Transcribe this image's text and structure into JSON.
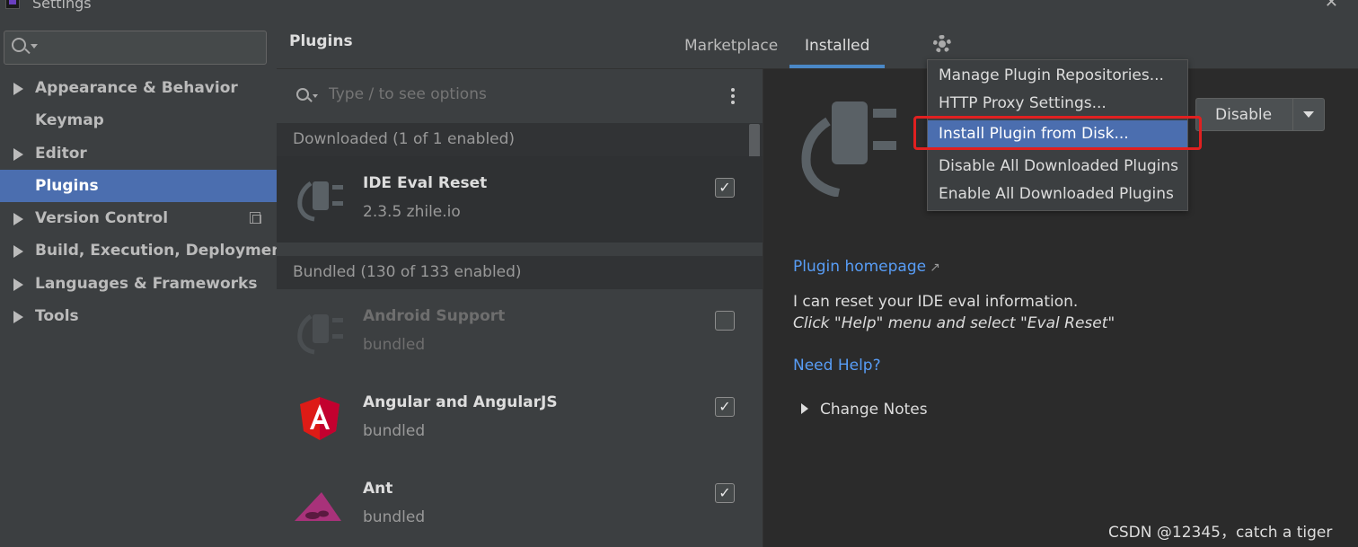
{
  "window": {
    "title": "Settings"
  },
  "sidebar": {
    "search_placeholder": "",
    "items": [
      {
        "label": "Appearance & Behavior",
        "expandable": true,
        "selected": false
      },
      {
        "label": "Keymap",
        "expandable": false,
        "selected": false
      },
      {
        "label": "Editor",
        "expandable": true,
        "selected": false
      },
      {
        "label": "Plugins",
        "expandable": false,
        "selected": true
      },
      {
        "label": "Version Control",
        "expandable": true,
        "selected": false
      },
      {
        "label": "Build, Execution, Deployment",
        "expandable": true,
        "selected": false
      },
      {
        "label": "Languages & Frameworks",
        "expandable": true,
        "selected": false
      },
      {
        "label": "Tools",
        "expandable": true,
        "selected": false
      }
    ]
  },
  "header": {
    "title": "Plugins",
    "tabs": [
      {
        "label": "Marketplace",
        "active": false
      },
      {
        "label": "Installed",
        "active": true
      }
    ]
  },
  "plugin_list": {
    "search_placeholder": "Type / to see options",
    "sections": [
      {
        "header": "Downloaded (1 of 1 enabled)",
        "plugins": [
          {
            "name": "IDE Eval Reset",
            "subtitle": "2.3.5  zhile.io",
            "enabled": true,
            "icon": "plug-icon"
          }
        ]
      },
      {
        "header": "Bundled (130 of 133 enabled)",
        "plugins": [
          {
            "name": "Android Support",
            "subtitle": "bundled",
            "enabled": false,
            "icon": "plug-icon"
          },
          {
            "name": "Angular and AngularJS",
            "subtitle": "bundled",
            "enabled": true,
            "icon": "angular-icon"
          },
          {
            "name": "Ant",
            "subtitle": "bundled",
            "enabled": true,
            "icon": "ant-icon"
          }
        ]
      }
    ]
  },
  "detail": {
    "disable_label": "Disable",
    "homepage_link": "Plugin homepage",
    "homepage_arrow": "↗",
    "description_line1": "I can reset your IDE eval information.",
    "description_line2": "Click \"Help\" menu and select \"Eval Reset\"",
    "help_link": "Need Help?",
    "change_notes": "Change Notes"
  },
  "gear_menu": {
    "items": [
      {
        "label": "Manage Plugin Repositories...",
        "highlighted": false
      },
      {
        "label": "HTTP Proxy Settings...",
        "highlighted": false
      },
      {
        "label": "Install Plugin from Disk...",
        "highlighted": true
      },
      {
        "label": "Disable All Downloaded Plugins",
        "highlighted": false
      },
      {
        "label": "Enable All Downloaded Plugins",
        "highlighted": false
      }
    ]
  },
  "colors": {
    "selection": "#4b6eaf",
    "link": "#589df6",
    "annotation": "#e02020",
    "angular": "#dd1b16",
    "ant": "#a8327a"
  },
  "watermark": "CSDN @12345，catch a tiger",
  "checkmark": "✓"
}
